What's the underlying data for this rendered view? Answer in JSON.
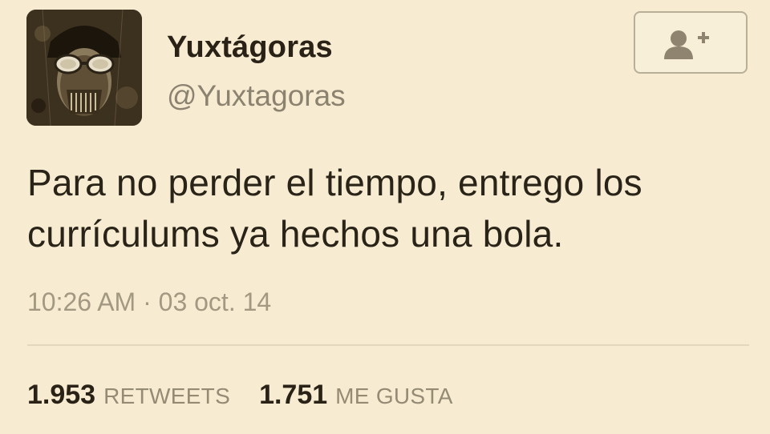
{
  "tweet": {
    "author": {
      "display_name": "Yuxtágoras",
      "handle": "@Yuxtagoras"
    },
    "follow_button_icon": "add-user-icon",
    "text": "Para no perder el tiempo, entrego los currículums ya hechos una bola.",
    "timestamp": "10:26 AM · 03 oct. 14",
    "stats": {
      "retweets_count": "1.953",
      "retweets_label": "RETWEETS",
      "likes_count": "1.751",
      "likes_label": "ME GUSTA"
    }
  },
  "colors": {
    "background": "#f7ecd2",
    "text_primary": "#2a2216",
    "text_secondary": "#8c8270",
    "divider": "#e3d7bd"
  }
}
